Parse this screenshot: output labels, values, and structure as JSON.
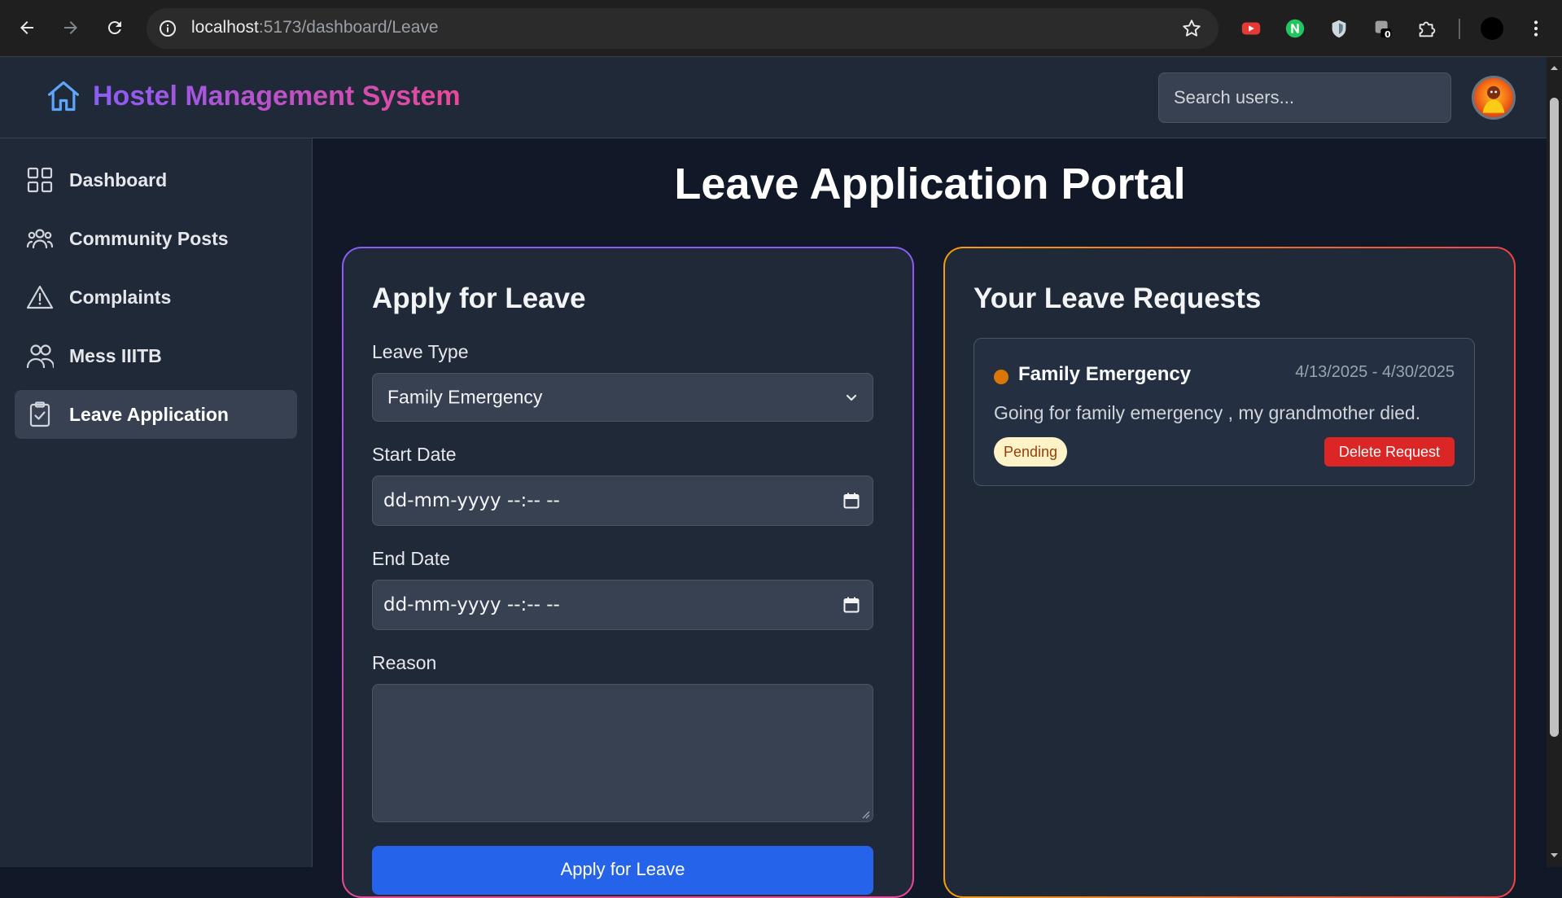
{
  "browser": {
    "url_host": "localhost",
    "url_path": ":5173/dashboard/Leave",
    "ext_badge": "0"
  },
  "header": {
    "title": "Hostel Management System",
    "search_placeholder": "Search users..."
  },
  "sidebar": {
    "items": [
      {
        "label": "Dashboard",
        "icon": "grid-icon"
      },
      {
        "label": "Community Posts",
        "icon": "users-icon"
      },
      {
        "label": "Complaints",
        "icon": "warning-icon"
      },
      {
        "label": "Mess IIITB",
        "icon": "people-icon"
      },
      {
        "label": "Leave Application",
        "icon": "clipboard-check-icon",
        "active": true
      }
    ]
  },
  "main": {
    "title": "Leave Application Portal",
    "apply": {
      "heading": "Apply for Leave",
      "leave_type_label": "Leave Type",
      "leave_type_value": "Family Emergency",
      "start_label": "Start Date",
      "start_value": "dd-mm-yyyy --:-- --",
      "end_label": "End Date",
      "end_value": "dd-mm-yyyy --:-- --",
      "reason_label": "Reason",
      "reason_value": "",
      "submit_label": "Apply for Leave"
    },
    "requests": {
      "heading": "Your Leave Requests",
      "items": [
        {
          "type": "Family Emergency",
          "dates": "4/13/2025 - 4/30/2025",
          "reason": "Going for family emergency , my grandmother died.",
          "status": "Pending",
          "delete_label": "Delete Request"
        }
      ]
    }
  },
  "colors": {
    "accent_purple": "#8b5cf6",
    "accent_pink": "#ec4899",
    "accent_orange": "#f59e0b",
    "status_pending_bg": "#fef3c7",
    "status_pending_text": "#92400e",
    "pending_dot": "#d97706",
    "delete_red": "#dc2626",
    "primary_blue": "#2563eb"
  }
}
